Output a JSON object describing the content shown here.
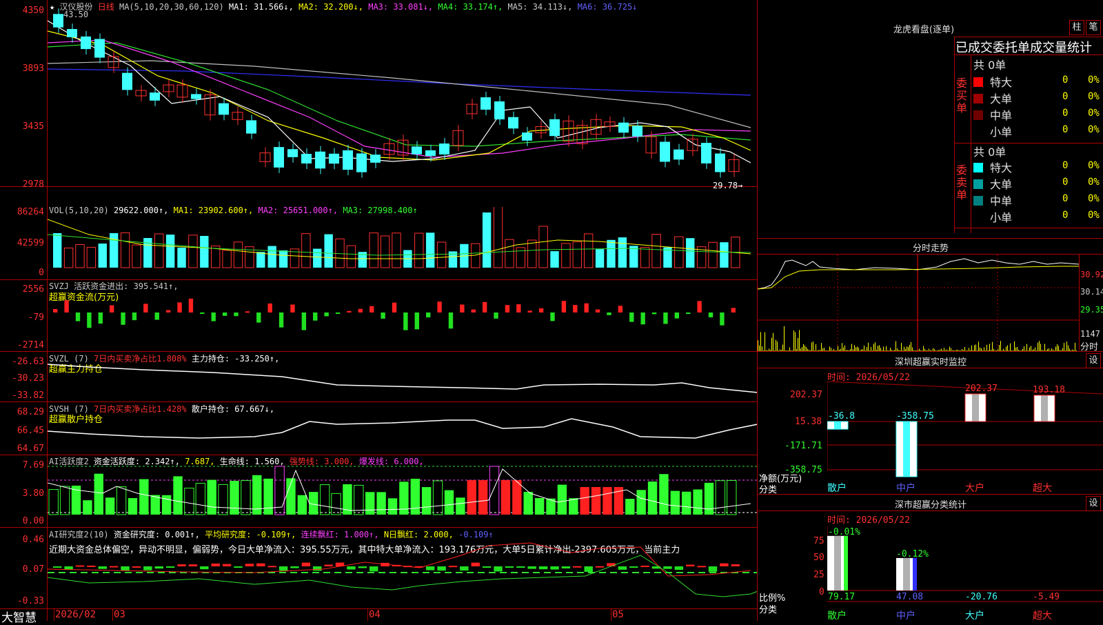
{
  "colors": {
    "up": "#ff3030",
    "down": "#40ffff",
    "bg": "#000000",
    "grid": "#b00000"
  },
  "kline": {
    "star": "★",
    "stock_name": "汉仪股份",
    "period": "日线",
    "ma_label": "MA(5,10,20,30,60,120)",
    "ma1": "MA1: 31.566↓,",
    "ma2": "MA2: 32.200↓,",
    "ma3": "MA3: 33.081↓,",
    "ma4": "MA4: 33.174↑,",
    "ma5": "MA5: 34.113↓,",
    "ma6": "MA6: 36.725↓",
    "high_marker": "43.50",
    "low_marker": "29.78→",
    "y_labels": [
      "4350",
      "3893",
      "3435",
      "2978"
    ]
  },
  "vol": {
    "label": "VOL(5,10,20)",
    "value": "29622.000↑,",
    "ma1": "MA1: 23902.600↑,",
    "ma2": "MA2: 25651.000↑,",
    "ma3": "MA3: 27998.400↑",
    "y_labels": [
      "86264",
      "42599",
      "0"
    ]
  },
  "svzj": {
    "label": "SVZJ  活跃资金进出: 395.541↑,",
    "sub": "超赢资金流(万元)",
    "y_labels": [
      "2556",
      "-79",
      "-2714"
    ]
  },
  "svzl": {
    "label": "SVZL (7)",
    "a": "7日内买卖净占比1.808%",
    "b": "主力持仓: -33.250↑,",
    "sub": "超赢主力持仓",
    "y_labels": [
      "-26.63",
      "-30.23",
      "-33.82"
    ]
  },
  "svsh": {
    "label": "SVSH (7)",
    "a": "7日内买卖净占比1.428%",
    "b": "散户持仓: 67.667↓,",
    "sub": "超赢散户持仓",
    "y_labels": [
      "68.29",
      "66.45",
      "64.67"
    ]
  },
  "ai1": {
    "label": "AI活跃度2",
    "a": "资金活跃度: 2.342↑,",
    "b": "7.687,",
    "c": "生命线: 1.560,",
    "d": "强势线: 3.000,",
    "e": "爆发线: 6.000,",
    "y_labels": [
      "7.69",
      "3.80",
      "0.00"
    ]
  },
  "ai2": {
    "label": "AI研究度2(10)",
    "a": "资金研究度: 0.001↑,",
    "b": "平均研究度: -0.109↑,",
    "c": "连续飘红: 1.000↑,",
    "d": "N日飘红: 2.000,",
    "e": "-0.109↑",
    "text": "近期大资金总体偏空，异动不明显，偏弱势，今日大单净流入：395.55万元，其中特大单净流入：193.176万元，大单5日累计净出-2397.605万元，当前主力",
    "y_labels": [
      "0.46",
      "0.07",
      "-0.33"
    ]
  },
  "xaxis": {
    "brand": "大智慧",
    "dates": [
      "2026/02",
      "03",
      "04",
      "05"
    ]
  },
  "longhu": {
    "title": "龙虎看盘(逐单)",
    "btn1": "柱",
    "btn2": "笔",
    "tabs": "已成交委托单成交量统计",
    "buy_label": "委买单",
    "sell_label": "委卖单",
    "buy_total": "共 0单",
    "sell_total": "共 0单",
    "rows": [
      {
        "name": "特大",
        "count": "0",
        "pct": "0%"
      },
      {
        "name": "大单",
        "count": "0",
        "pct": "0%"
      },
      {
        "name": "中单",
        "count": "0",
        "pct": "0%"
      },
      {
        "name": "小单",
        "count": "0",
        "pct": "0%"
      }
    ],
    "sell_rows": [
      {
        "name": "特大",
        "count": "0",
        "pct": "0%"
      },
      {
        "name": "大单",
        "count": "0",
        "pct": "0%"
      },
      {
        "name": "中单",
        "count": "0",
        "pct": "0%"
      },
      {
        "name": "小单",
        "count": "0",
        "pct": "0%"
      }
    ]
  },
  "fenshi": {
    "title": "分时走势",
    "y_labels": [
      "30.92",
      "30.14",
      "29.35"
    ],
    "vol_label": "1147",
    "fenshi_label": "分时"
  },
  "shenzhen": {
    "title": "深圳超赢实时监控",
    "settings": "设",
    "time": "时间: 2026/05/22",
    "y_labels": [
      "202.37",
      "15.38",
      "-171.71",
      "-358.75"
    ],
    "net_label": "净额(万元)",
    "cat_label": "分类",
    "cats": [
      "散户",
      "中户",
      "大户",
      "超大"
    ],
    "values": [
      "-36.8",
      "-358.75",
      "202.37",
      "193.18"
    ]
  },
  "classify": {
    "title": "深市超赢分类统计",
    "settings": "设",
    "time": "时间: 2026/05/22",
    "y_labels": [
      "75",
      "50",
      "25",
      "0"
    ],
    "ratio_label": "比例%",
    "cat_label": "分类",
    "top_values": [
      "-0.01%",
      "-0.12%"
    ],
    "bottom_values": [
      "79.17",
      "47.08",
      "-20.76",
      "-5.49"
    ],
    "cats": [
      "散户",
      "中户",
      "大户",
      "超大"
    ]
  }
}
